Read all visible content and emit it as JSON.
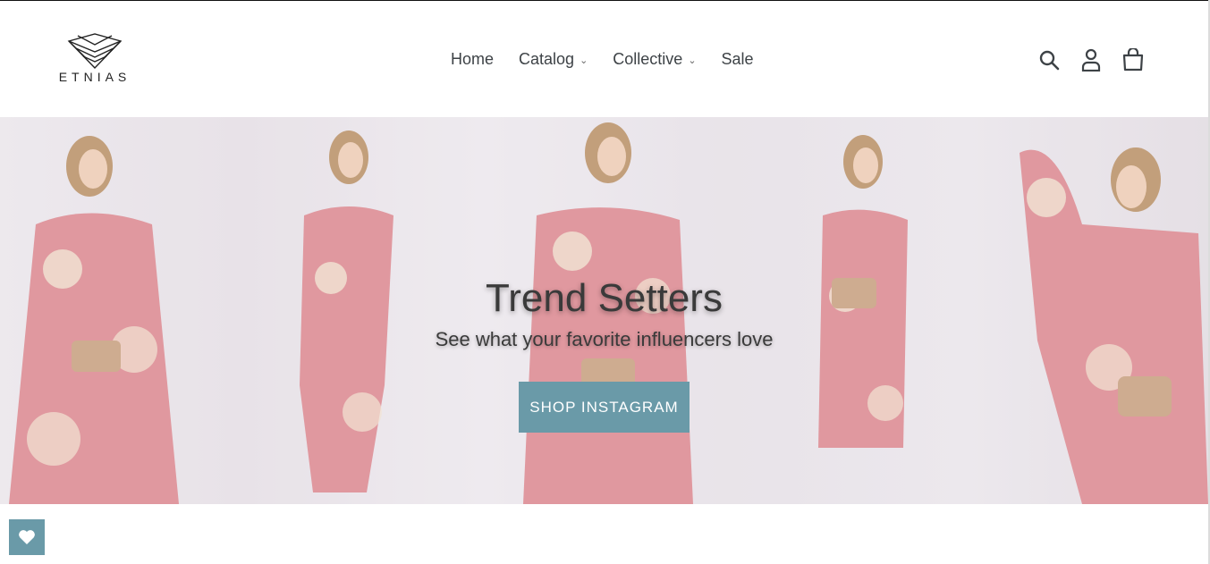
{
  "brand": {
    "name": "ETNIAS"
  },
  "nav": {
    "items": [
      {
        "label": "Home"
      },
      {
        "label": "Catalog"
      },
      {
        "label": "Collective"
      },
      {
        "label": "Sale"
      }
    ]
  },
  "header_icons": [
    "search-icon",
    "account-icon",
    "cart-icon"
  ],
  "hero": {
    "title": "Trend Setters",
    "subtitle": "See what your favorite influencers love",
    "button_label": "SHOP INSTAGRAM"
  },
  "colors": {
    "accent": "#6a9aa8",
    "text": "#3a3a3a",
    "dress_pink": "#d9828a",
    "dress_cream": "#efe0cc"
  },
  "floating": {
    "icon": "heart-icon"
  }
}
